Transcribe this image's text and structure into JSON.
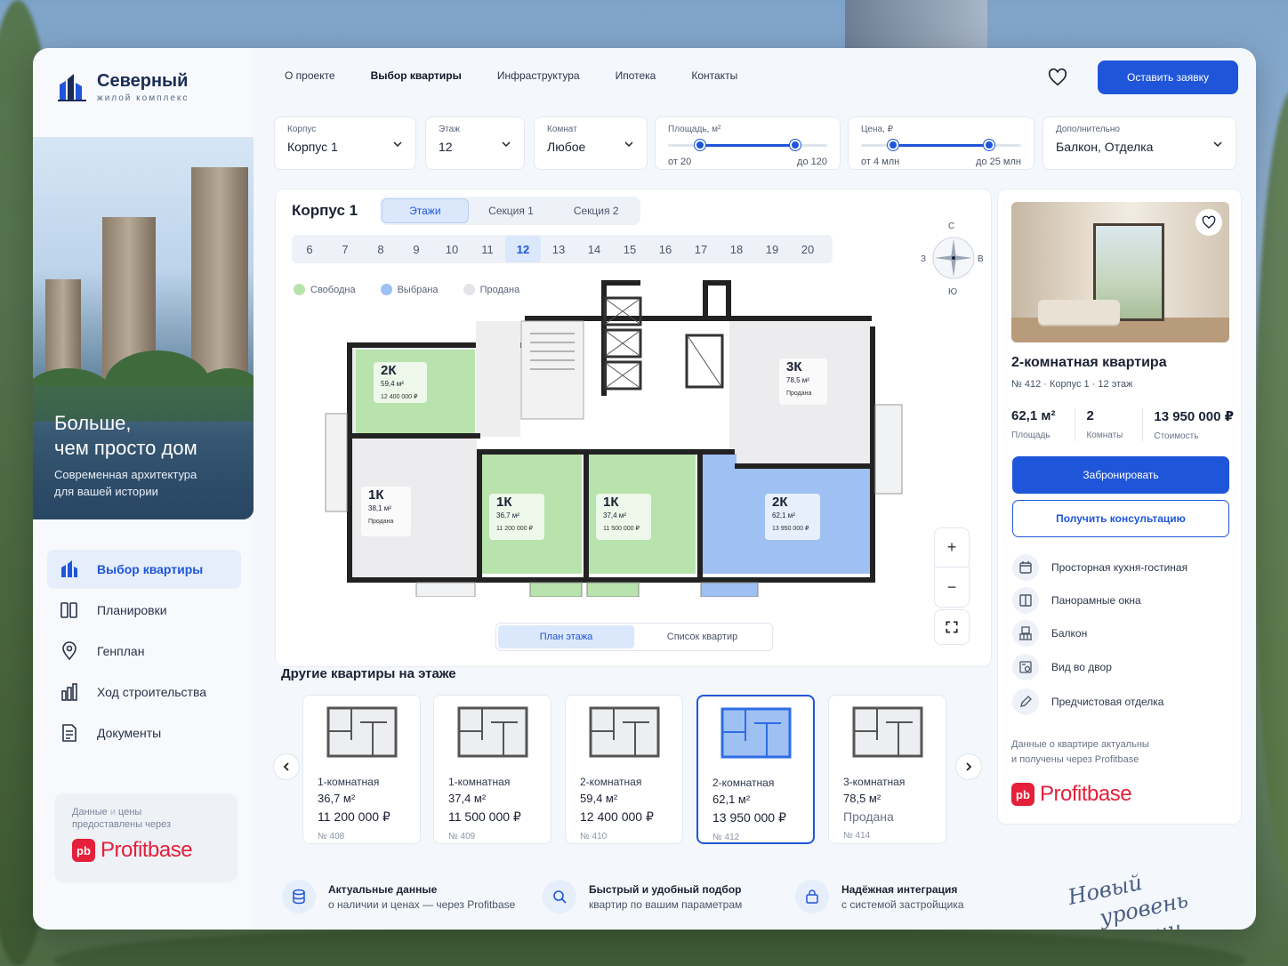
{
  "brand": {
    "name": "Северный",
    "sub": "жилой комплекс"
  },
  "hero": {
    "title1": "Больше,",
    "title2": "чем просто дом",
    "sub1": "Современная архитектура",
    "sub2": "для вашей истории"
  },
  "sidenav": [
    {
      "label": "Выбор квартиры",
      "icon": "buildings-icon",
      "active": true
    },
    {
      "label": "Планировки",
      "icon": "layout-icon"
    },
    {
      "label": "Генплан",
      "icon": "map-pin-icon"
    },
    {
      "label": "Ход строительства",
      "icon": "chart-icon"
    },
    {
      "label": "Документы",
      "icon": "document-icon"
    }
  ],
  "pb_note": {
    "line1a": "Данные",
    "line1b": "и",
    "line1c": "цены",
    "line2": "предоставлены через",
    "brand": "Profitbase",
    "mark": "pb"
  },
  "topnav": [
    "О проекте",
    "Выбор квартиры",
    "Инфраструктура",
    "Ипотека",
    "Контакты"
  ],
  "cta": "Оставить заявку",
  "filters": {
    "korpus": {
      "label": "Корпус",
      "value": "Корпус 1"
    },
    "etazh": {
      "label": "Этаж",
      "value": "12"
    },
    "komnat": {
      "label": "Комнат",
      "value": "Любое"
    },
    "area": {
      "label": "Площадь, м²",
      "from": "от 20",
      "to": "до 120",
      "min_frac": 0.2,
      "max_frac": 0.8
    },
    "price": {
      "label": "Цена, ₽",
      "from": "от 4 млн",
      "to": "до 25 млн",
      "min_frac": 0.2,
      "max_frac": 0.8
    },
    "extra": {
      "label": "Дополнительно",
      "value": "Балкон, Отделка"
    }
  },
  "building": {
    "title": "Корпус 1",
    "tabs": [
      "Этажи",
      "Секция 1",
      "Секция 2"
    ],
    "floors": [
      "6",
      "7",
      "8",
      "9",
      "10",
      "11",
      "12",
      "13",
      "14",
      "15",
      "16",
      "17",
      "18",
      "19",
      "20"
    ],
    "active_floor": "12"
  },
  "legend": [
    {
      "label": "Свободна",
      "color": "#b9e3ad"
    },
    {
      "label": "Выбрана",
      "color": "#9ec0f2"
    },
    {
      "label": "Продана",
      "color": "#e2e4e8"
    }
  ],
  "compass": {
    "n": "С",
    "s": "Ю",
    "w": "З",
    "e": "В"
  },
  "plan_labels": [
    {
      "t": "2К",
      "a": "59,4 м²",
      "p": "12 400 000 ₽"
    },
    {
      "t": "3К",
      "a": "78,5 м²",
      "p": "Продана"
    },
    {
      "t": "1К",
      "a": "38,1 м²",
      "p": "Продана"
    },
    {
      "t": "1К",
      "a": "36,7 м²",
      "p": "11 200 000 ₽"
    },
    {
      "t": "1К",
      "a": "37,4 м²",
      "p": "11 500 000 ₽"
    },
    {
      "t": "2К",
      "a": "62,1 м²",
      "p": "13 950 000 ₽"
    }
  ],
  "zoom": {
    "plus": "+",
    "minus": "−"
  },
  "view_toggle": [
    "План этажа",
    "Список квартир"
  ],
  "other_title": "Другие квартиры на этаже",
  "cards": [
    {
      "type": "1-комнатная",
      "area": "36,7 м²",
      "price": "11 200 000 ₽",
      "num": "№ 408"
    },
    {
      "type": "1-комнатная",
      "area": "37,4 м²",
      "price": "11 500 000 ₽",
      "num": "№ 409"
    },
    {
      "type": "2-комнатная",
      "area": "59,4 м²",
      "price": "12 400 000 ₽",
      "num": "№ 410"
    },
    {
      "type": "2-комнатная",
      "area": "62,1 м²",
      "price": "13 950 000 ₽",
      "num": "№ 412"
    },
    {
      "type": "3-комнатная",
      "area": "78,5 м²",
      "price": "Продана",
      "num": "№ 414"
    }
  ],
  "features": [
    {
      "t1": "Актуальные данные",
      "t2": "о наличии и ценах — через Profitbase",
      "icon": "database-icon"
    },
    {
      "t1": "Быстрый и удобный подбор",
      "t2": "квартир по вашим параметрам",
      "icon": "search-icon"
    },
    {
      "t1": "Надёжная интеграция",
      "t2": "с системой застройщика",
      "icon": "lock-bag-icon"
    }
  ],
  "slogan": {
    "l1": "Новый",
    "l2": "уровень жизни"
  },
  "apartment": {
    "title": "2-комнатная квартира",
    "sub": "№ 412  ·  Корпус 1 · 12 этаж",
    "area": "62,1 м²",
    "area_l": "Площадь",
    "rooms": "2",
    "rooms_l": "Комнаты",
    "price": "13 950 000 ₽",
    "price_l": "Стоимость",
    "book": "Забронировать",
    "consult": "Получить консультацию",
    "features": [
      {
        "label": "Просторная кухня-гостиная",
        "icon": "kitchen-icon"
      },
      {
        "label": "Панорамные окна",
        "icon": "window-icon"
      },
      {
        "label": "Балкон",
        "icon": "balcony-icon"
      },
      {
        "label": "Вид во двор",
        "icon": "view-icon"
      },
      {
        "label": "Предчистовая отделка",
        "icon": "pencil-icon"
      }
    ],
    "note1": "Данные о квартире актуальны",
    "note2": "и получены через Profitbase"
  }
}
